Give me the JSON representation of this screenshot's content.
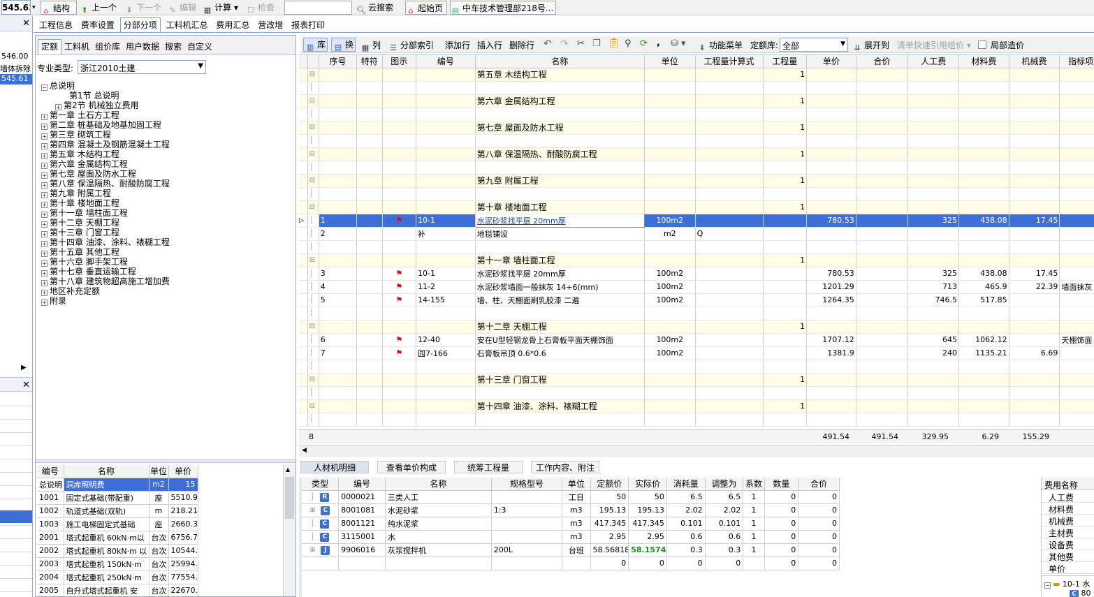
{
  "toolbar": {
    "value": "545.61",
    "structure": "结构",
    "prev": "上一个",
    "next": "下一个",
    "edit": "编辑",
    "calc": "计算",
    "check": "检查",
    "cloud_search": "云搜索",
    "start_page": "起始页",
    "doc_tab": "中车技术管理部218号..."
  },
  "left_strip": {
    "v1": "546.00",
    "v2": "墙体拆除",
    "v3": "545.61"
  },
  "main_tabs": [
    "工程信息",
    "费率设置",
    "分部分项",
    "工料机汇总",
    "费用汇总",
    "营改增",
    "报表打印"
  ],
  "lib_tabs": [
    "定额",
    "工料机",
    "组价库",
    "用户数据",
    "搜索",
    "自定义"
  ],
  "specialty_label": "专业类型:",
  "specialty_value": "浙江2010土建",
  "tree": [
    "总说明",
    "第1节 总说明",
    "第2节 机械独立费用",
    "第一章 土石方工程",
    "第二章 桩基础及地基加固工程",
    "第三章 砌筑工程",
    "第四章 混凝土及钢筋混凝土工程",
    "第五章 木结构工程",
    "第六章 金属结构工程",
    "第七章 屋面及防水工程",
    "第八章 保温隔热、耐酸防腐工程",
    "第九章 附属工程",
    "第十章 楼地面工程",
    "第十一章 墙柱面工程",
    "第十二章 天棚工程",
    "第十三章 门窗工程",
    "第十四章 油漆、涂料、裱糊工程",
    "第十五章 其他工程",
    "第十六章 脚手架工程",
    "第十七章 垂直运输工程",
    "第十八章 建筑物超高施工增加费",
    "地区补充定额",
    "附录"
  ],
  "lib_table": {
    "headers": [
      "编号",
      "名称",
      "单位",
      "单价"
    ],
    "rows": [
      [
        "总说明",
        "洞库照明费",
        "m2",
        "15"
      ],
      [
        "1001",
        "固定式基础(带配重)",
        "座",
        "5510.9"
      ],
      [
        "1002",
        "轨道式基础(双轨)",
        "m",
        "218.21"
      ],
      [
        "1003",
        "施工电梯固定式基础",
        "座",
        "2660.3"
      ],
      [
        "2001",
        "塔式起重机 60kN·m以",
        "台次",
        "6756.7"
      ],
      [
        "2002",
        "塔式起重机 80kN·m 以",
        "台次",
        "10544."
      ],
      [
        "2003",
        "塔式起重机 150kN·m",
        "台次",
        "25994."
      ],
      [
        "2004",
        "塔式起重机 250kN·m",
        "台次",
        "77554."
      ],
      [
        "2005",
        "自升式塔式起重机 安",
        "台次",
        "22670."
      ]
    ]
  },
  "grid_toolbar": {
    "lib": "库",
    "swap": "换",
    "col": "列",
    "index": "分部索引",
    "add": "添加行",
    "insert": "插入行",
    "delete": "删除行",
    "func_menu": "功能菜单",
    "quota_lib_label": "定额库:",
    "quota_lib_value": "全部",
    "expand": "展开到",
    "quick_ref": "清单快速引用组价",
    "local_cost": "局部造价"
  },
  "grid": {
    "headers": [
      "序号",
      "特符",
      "图示",
      "编号",
      "名称",
      "单位",
      "工程量计算式",
      "工程量",
      "单价",
      "合价",
      "人工费",
      "材料费",
      "机械费",
      "指标项"
    ],
    "rows": [
      {
        "t": "ch",
        "name": "第五章 木结构工程",
        "qty": "1"
      },
      {
        "t": "e"
      },
      {
        "t": "ch",
        "name": "第六章 金属结构工程",
        "qty": "1"
      },
      {
        "t": "e"
      },
      {
        "t": "ch",
        "name": "第七章 屋面及防水工程",
        "qty": "1"
      },
      {
        "t": "e"
      },
      {
        "t": "ch",
        "name": "第八章 保温隔热、耐酸防腐工程",
        "qty": "1"
      },
      {
        "t": "e"
      },
      {
        "t": "ch",
        "name": "第九章 附属工程",
        "qty": "1"
      },
      {
        "t": "e"
      },
      {
        "t": "ch",
        "name": "第十章 楼地面工程",
        "qty": "1"
      },
      {
        "t": "sel",
        "seq": "1",
        "flag": "⚑",
        "code": "10-1",
        "name": "水泥砂浆找平层 20mm厚",
        "unit": "100m2",
        "price": "780.53",
        "labor": "325",
        "mat": "438.08",
        "mach": "17.45"
      },
      {
        "t": "it",
        "seq": "2",
        "code": "补",
        "name": "地毯铺设",
        "unit": "m2",
        "formula": "Q"
      },
      {
        "t": "e"
      },
      {
        "t": "ch",
        "name": "第十一章 墙柱面工程",
        "qty": "1"
      },
      {
        "t": "it",
        "seq": "3",
        "flag": "⚑",
        "code": "10-1",
        "name": "水泥砂浆找平层 20mm厚",
        "unit": "100m2",
        "price": "780.53",
        "labor": "325",
        "mat": "438.08",
        "mach": "17.45"
      },
      {
        "t": "it",
        "seq": "4",
        "flag": "⚑",
        "code": "11-2",
        "name": "水泥砂浆墙面一般抹灰 14+6(mm)",
        "unit": "100m2",
        "price": "1201.29",
        "labor": "713",
        "mat": "465.9",
        "mach": "22.39",
        "idx": "墙面抹灰"
      },
      {
        "t": "it",
        "seq": "5",
        "flag": "⚑",
        "code": "14-155",
        "name": "墙、柱、天棚面刷乳胶漆 二遍",
        "unit": "100m2",
        "price": "1264.35",
        "labor": "746.5",
        "mat": "517.85"
      },
      {
        "t": "e"
      },
      {
        "t": "ch",
        "name": "第十二章 天棚工程",
        "qty": "1"
      },
      {
        "t": "it",
        "seq": "6",
        "flag": "⚑",
        "code": "12-40",
        "name": "安在U型轻钢龙骨上石膏板平面天棚饰面",
        "unit": "100m2",
        "price": "1707.12",
        "labor": "645",
        "mat": "1062.12",
        "idx": "天棚饰面"
      },
      {
        "t": "it",
        "seq": "7",
        "flag": "⚑",
        "code": "园7-166",
        "name": "石膏板吊顶 0.6*0.6",
        "unit": "100m2",
        "price": "1381.9",
        "labor": "240",
        "mat": "1135.21",
        "mach": "6.69"
      },
      {
        "t": "e"
      },
      {
        "t": "ch",
        "name": "第十三章 门窗工程",
        "qty": "1"
      },
      {
        "t": "e"
      },
      {
        "t": "ch",
        "name": "第十四章 油漆、涂料、裱糊工程",
        "qty": "1"
      },
      {
        "t": "e"
      }
    ],
    "footer": {
      "count": "8",
      "price": "491.54",
      "total": "491.54",
      "labor": "329.95",
      "mat": "6.29",
      "mach": "155.29"
    }
  },
  "detail_tabs": [
    "人材机明细",
    "查看单价构成",
    "统筹工程量",
    "工作内容、附注"
  ],
  "detail": {
    "headers": [
      "类型",
      "编号",
      "名称",
      "规格型号",
      "单位",
      "定额价",
      "实际价",
      "消耗量",
      "调整为",
      "系数",
      "数量",
      "合价"
    ],
    "rows": [
      [
        "R",
        "0000021",
        "三类人工",
        "",
        "工日",
        "50",
        "50",
        "6.5",
        "6.5",
        "1",
        "0",
        "0"
      ],
      [
        "C",
        "8001081",
        "水泥砂浆",
        "1:3",
        "m3",
        "195.13",
        "195.13",
        "2.02",
        "2.02",
        "1",
        "0",
        "0"
      ],
      [
        "C",
        "8001121",
        "纯水泥浆",
        "",
        "m3",
        "417.345",
        "417.345",
        "0.101",
        "0.101",
        "1",
        "0",
        "0"
      ],
      [
        "C",
        "3115001",
        "水",
        "",
        "m3",
        "2.95",
        "2.95",
        "0.6",
        "0.6",
        "1",
        "0",
        "0"
      ],
      [
        "J",
        "9906016",
        "灰浆搅拌机",
        "200L",
        "台班",
        "58.56818",
        "58.15742",
        "0.3",
        "0.3",
        "1",
        "0",
        "0"
      ],
      [
        "",
        "",
        "",
        "",
        "",
        "0",
        "0",
        "0",
        "0",
        "",
        "0",
        "0"
      ]
    ]
  },
  "cost_panel": {
    "header": "费用名称",
    "items": [
      "人工费",
      "材料费",
      "机械费",
      "主材费",
      "设备费",
      "其他费",
      "单价"
    ],
    "tree_item": "10-1 水",
    "tree_sub": "80"
  }
}
